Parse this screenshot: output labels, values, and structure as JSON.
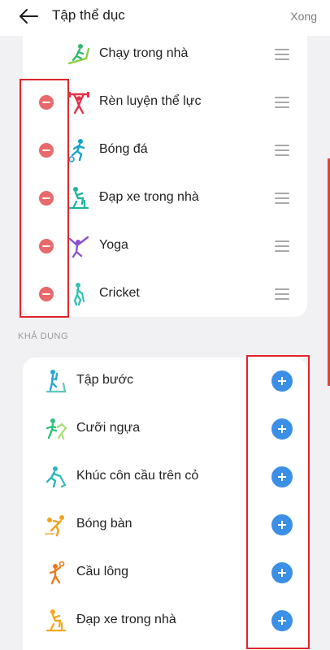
{
  "header": {
    "title": "Tập thể dục",
    "done_label": "Xong"
  },
  "selected": [
    {
      "label": "Chạy trong nhà",
      "icon": "treadmill-icon",
      "removable": false
    },
    {
      "label": "Rèn luyện thể lực",
      "icon": "weightlifting-icon",
      "removable": true
    },
    {
      "label": "Bóng đá",
      "icon": "soccer-icon",
      "removable": true
    },
    {
      "label": "Đạp xe trong nhà",
      "icon": "indoor-cycling-icon",
      "removable": true
    },
    {
      "label": "Yoga",
      "icon": "yoga-icon",
      "removable": true
    },
    {
      "label": "Cricket",
      "icon": "cricket-icon",
      "removable": true
    }
  ],
  "available_section": "KHẢ DỤNG",
  "available": [
    {
      "label": "Tập bước",
      "icon": "stepper-icon"
    },
    {
      "label": "Cưỡi ngựa",
      "icon": "horse-riding-icon"
    },
    {
      "label": "Khúc côn cầu trên cỏ",
      "icon": "field-hockey-icon"
    },
    {
      "label": "Bóng bàn",
      "icon": "table-tennis-icon"
    },
    {
      "label": "Cầu lông",
      "icon": "badminton-icon"
    },
    {
      "label": "Đạp xe trong nhà",
      "icon": "indoor-cycling-icon"
    }
  ],
  "colors": {
    "remove": "#e8696b",
    "add": "#3b8fe6",
    "highlight": "#e0252b"
  }
}
